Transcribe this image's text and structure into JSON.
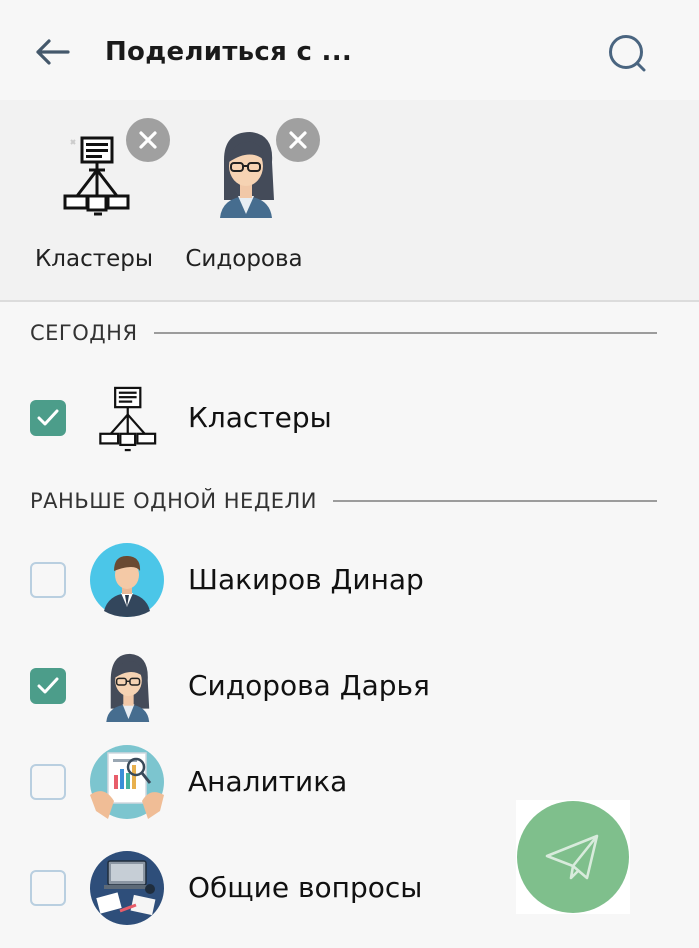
{
  "header": {
    "title": "Поделиться с ...",
    "back_icon": "arrow-left-icon",
    "search_icon": "search-icon"
  },
  "selected": [
    {
      "name": "Кластеры",
      "icon": "cluster-network-icon"
    },
    {
      "name": "Сидорова",
      "icon": "woman-glasses-avatar"
    }
  ],
  "sections": {
    "today": "СЕГОДНЯ",
    "older": "РАНЬШЕ ОДНОЙ НЕДЕЛИ"
  },
  "today_items": [
    {
      "name": "Кластеры",
      "checked": true,
      "icon": "cluster-network-icon"
    }
  ],
  "older_items": [
    {
      "name": "Шакиров Динар",
      "checked": false,
      "icon": "man-avatar"
    },
    {
      "name": "Сидорова Дарья",
      "checked": true,
      "icon": "woman-glasses-avatar"
    },
    {
      "name": "Аналитика",
      "checked": false,
      "icon": "analytics-avatar"
    },
    {
      "name": "Общие вопросы",
      "checked": false,
      "icon": "general-questions-avatar"
    }
  ],
  "fab": {
    "icon": "send-paper-plane-icon"
  },
  "colors": {
    "accent_check": "#4c9d8a",
    "fab": "#7fbf8c",
    "remove_badge": "#a0a0a0",
    "background": "#f7f7f7"
  }
}
